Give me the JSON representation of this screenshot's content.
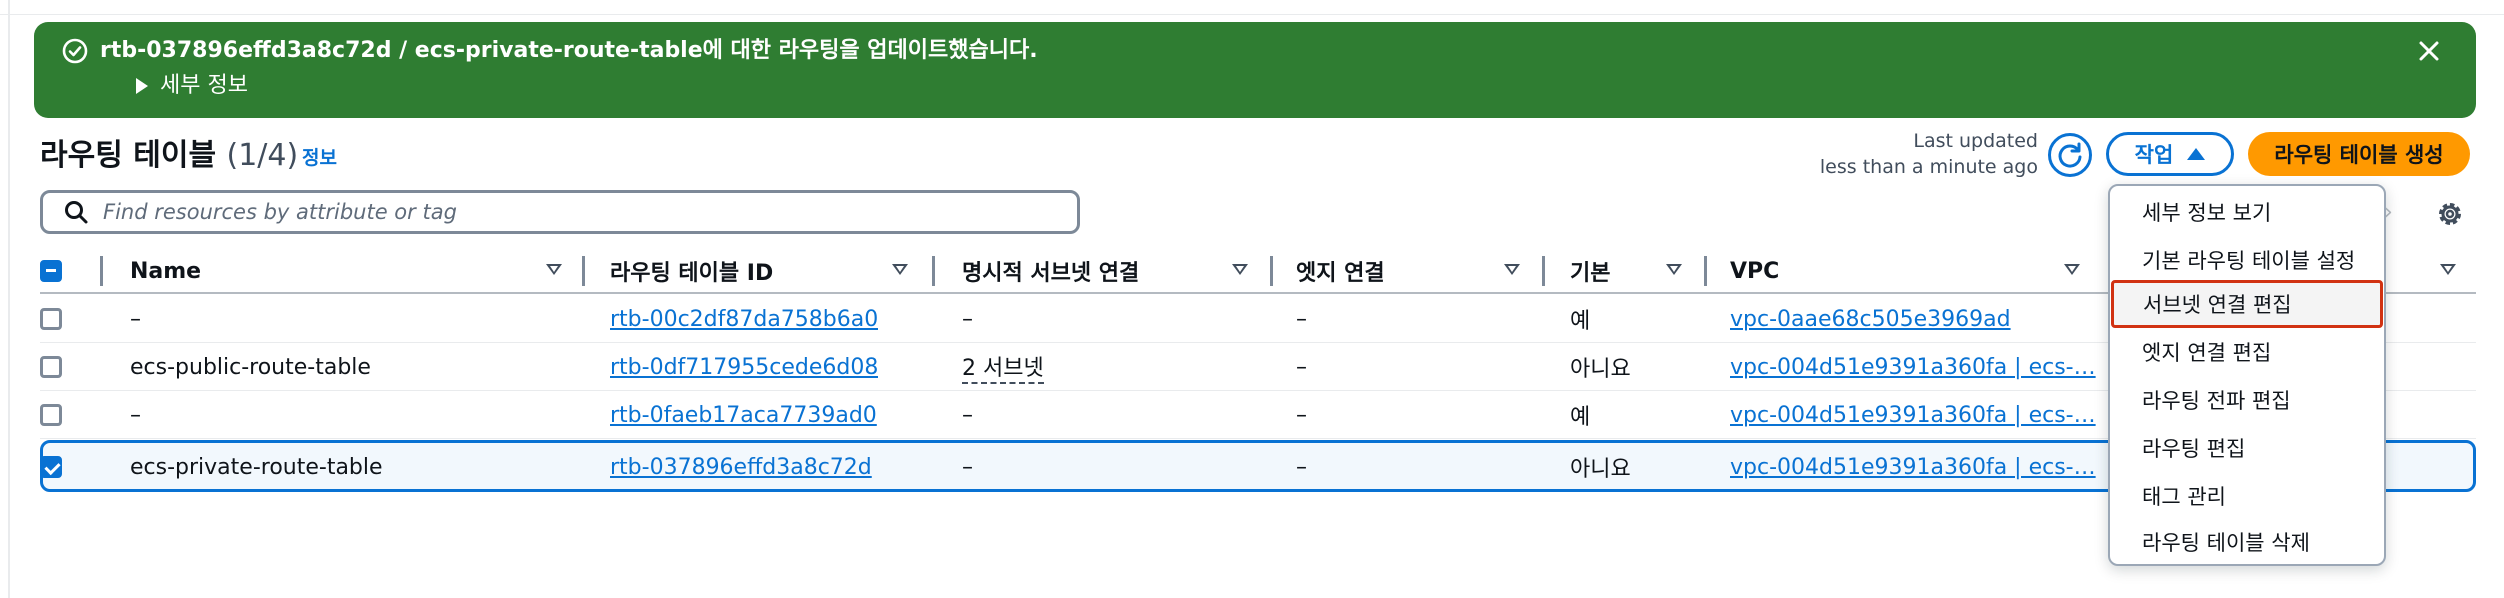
{
  "flash": {
    "message": "rtb-037896effd3a8c72d / ecs-private-route-table에 대한 라우팅을 업데이트했습니다.",
    "details": "세부 정보"
  },
  "header": {
    "title": "라우팅 테이블",
    "count": "(1/4)",
    "info": "정보",
    "last_updated_label": "Last updated",
    "last_updated_value": "less than a minute ago",
    "actions_label": "작업",
    "create_label": "라우팅 테이블 생성"
  },
  "search": {
    "placeholder": "Find resources by attribute or tag"
  },
  "table": {
    "columns": [
      "Name",
      "라우팅 테이블 ID",
      "명시적 서브넷 연결",
      "엣지 연결",
      "기본",
      "VPC"
    ],
    "rows": [
      {
        "selected": false,
        "name": "–",
        "id": "rtb-00c2df87da758b6a0",
        "subnet": "–",
        "edge": "–",
        "main": "예",
        "vpc": "vpc-0aae68c505e3969ad"
      },
      {
        "selected": false,
        "name": "ecs-public-route-table",
        "id": "rtb-0df717955cede6d08",
        "subnet": "2 서브넷",
        "edge": "–",
        "main": "아니요",
        "vpc": "vpc-004d51e9391a360fa | ecs-…"
      },
      {
        "selected": false,
        "name": "–",
        "id": "rtb-0faeb17aca7739ad0",
        "subnet": "–",
        "edge": "–",
        "main": "예",
        "vpc": "vpc-004d51e9391a360fa | ecs-…"
      },
      {
        "selected": true,
        "name": "ecs-private-route-table",
        "id": "rtb-037896effd3a8c72d",
        "subnet": "–",
        "edge": "–",
        "main": "아니요",
        "vpc": "vpc-004d51e9391a360fa | ecs-…"
      }
    ]
  },
  "actions_menu": {
    "items": [
      "세부 정보 보기",
      "기본 라우팅 테이블 설정",
      "서브넷 연결 편집",
      "엣지 연결 편집",
      "라우팅 전파 편집",
      "라우팅 편집",
      "태그 관리",
      "라우팅 테이블 삭제"
    ],
    "highlighted_index": 2
  },
  "colors": {
    "success_banner": "#2f7d32",
    "link": "#0972d3",
    "primary_button": "#ff9900",
    "highlight_border": "#d13212"
  }
}
